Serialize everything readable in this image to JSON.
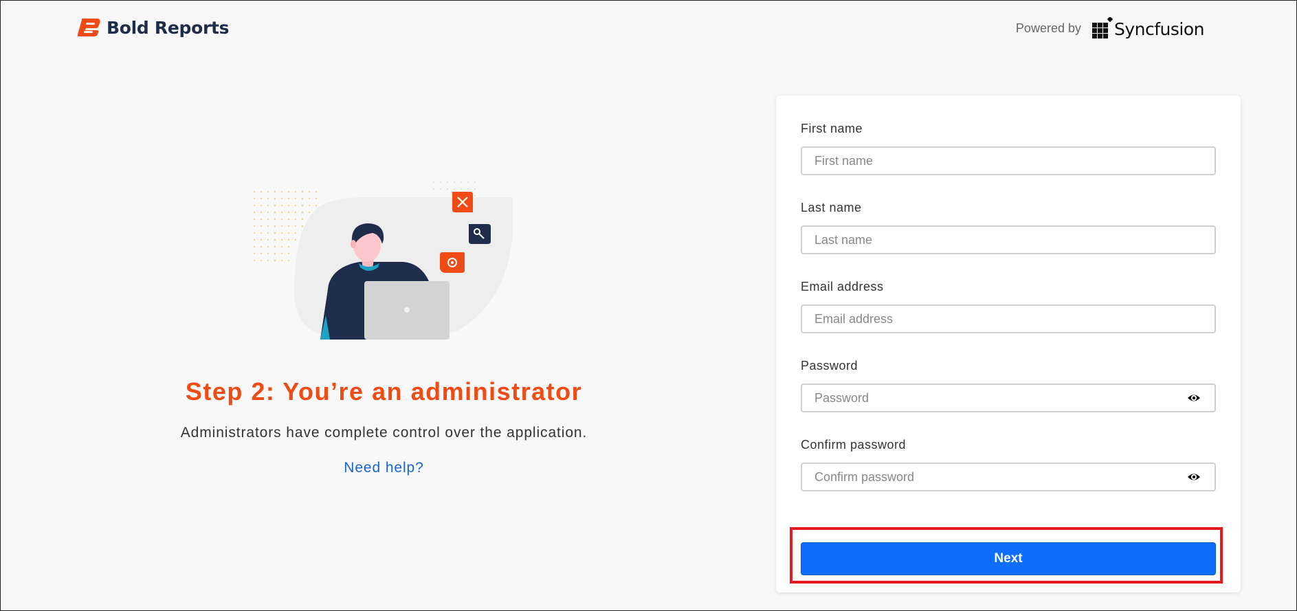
{
  "header": {
    "brand_name": "Bold Reports",
    "powered_label": "Powered by",
    "syncfusion_name": "Syncfusion"
  },
  "intro": {
    "title": "Step 2: You’re an administrator",
    "description": "Administrators have complete control over the application.",
    "help_link": "Need help?"
  },
  "form": {
    "first_name": {
      "label": "First name",
      "placeholder": "First name",
      "value": ""
    },
    "last_name": {
      "label": "Last name",
      "placeholder": "Last name",
      "value": ""
    },
    "email": {
      "label": "Email address",
      "placeholder": "Email address",
      "value": ""
    },
    "password": {
      "label": "Password",
      "placeholder": "Password",
      "value": ""
    },
    "confirm_password": {
      "label": "Confirm password",
      "placeholder": "Confirm password",
      "value": ""
    },
    "next_label": "Next"
  },
  "colors": {
    "brand_orange": "#f04b15",
    "brand_navy": "#1f2d4d",
    "primary_button": "#0d6efd",
    "link": "#1565d8",
    "highlight": "#e8181f"
  },
  "icons": {
    "brand": "bold-reports-logo",
    "syncfusion": "syncfusion-logo",
    "password_toggle": "eye-icon",
    "illustration": "administrator-illustration"
  }
}
